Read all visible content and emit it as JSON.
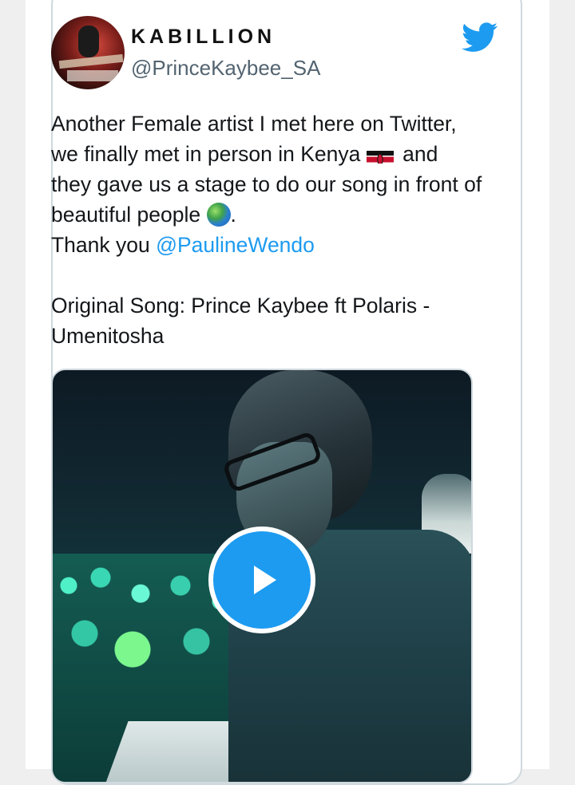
{
  "tweet": {
    "display_name": "KABILLION",
    "handle": "@PrinceKaybee_SA",
    "text_line1": "Another Female artist I met here on Twitter, we finally met in person in Kenya",
    "text_line2": "and they gave us a stage to do our song in front of beautiful people",
    "text_line2_end": ".",
    "thanks_prefix": "Thank you ",
    "mention": "@PaulineWendo",
    "original_song": "Original Song: Prince Kaybee ft Polaris - Umenitosha"
  },
  "icons": {
    "brand": "twitter-bird-icon",
    "flag": "kenya-flag-icon",
    "globe": "globe-icon",
    "play": "play-icon"
  },
  "colors": {
    "accent": "#1d9bf0",
    "text": "#14171a",
    "secondary": "#536471",
    "border": "#cfd9de"
  }
}
